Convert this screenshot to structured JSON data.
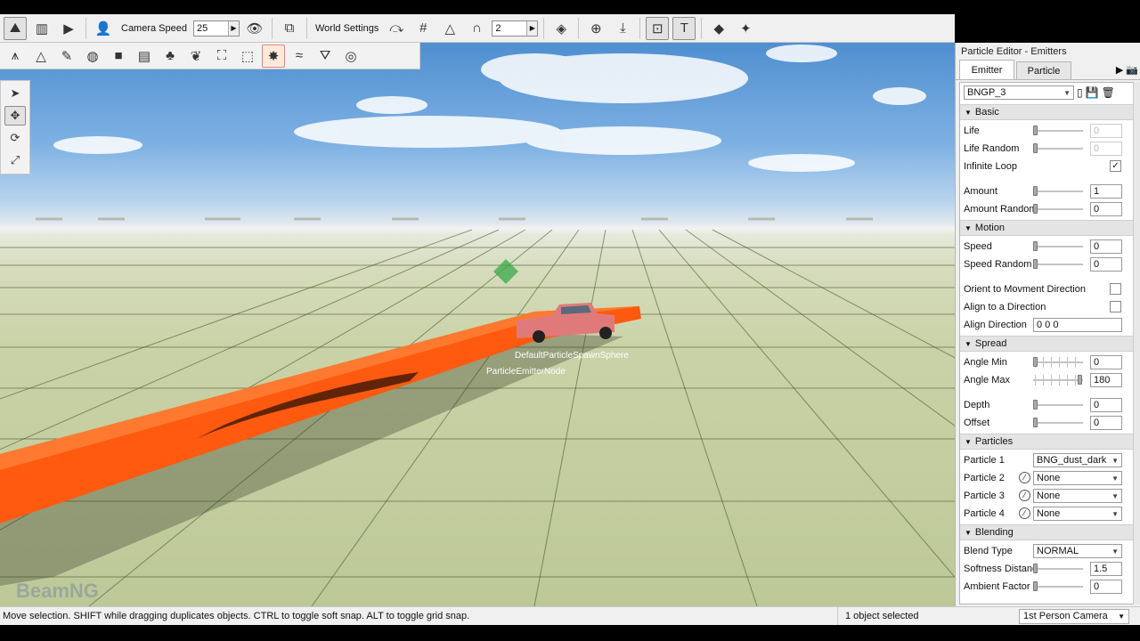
{
  "toolbar": {
    "camera_speed_label": "Camera Speed",
    "camera_speed_value": "25",
    "world_settings_label": "World Settings",
    "snap_value": "2"
  },
  "viewport": {
    "node_labels": [
      "DefaultParticleSpawnSphere",
      "ParticleEmitterNode"
    ],
    "watermark": "BeamNG"
  },
  "status": {
    "message": "Move selection.  SHIFT while dragging duplicates objects.  CTRL to toggle soft snap.  ALT to toggle grid snap.",
    "selection": "1 object selected",
    "camera": "1st Person Camera"
  },
  "panel": {
    "title": "Particle Editor - Emitters",
    "tabs": [
      "Emitter",
      "Particle"
    ],
    "emitter_name": "BNGP_3",
    "sections": {
      "basic": "Basic",
      "motion": "Motion",
      "spread": "Spread",
      "particles": "Particles",
      "blending": "Blending"
    },
    "basic": {
      "life": {
        "label": "Life",
        "value": "0"
      },
      "life_random": {
        "label": "Life Random",
        "value": "0"
      },
      "infinite_loop": {
        "label": "Infinite Loop",
        "checked": "✓"
      },
      "amount": {
        "label": "Amount",
        "value": "1"
      },
      "amount_random": {
        "label": "Amount Random",
        "value": "0"
      }
    },
    "motion": {
      "speed": {
        "label": "Speed",
        "value": "0"
      },
      "speed_random": {
        "label": "Speed Random",
        "value": "0"
      },
      "orient": {
        "label": "Orient to Movment Direction"
      },
      "align": {
        "label": "Align to a Direction"
      },
      "align_dir": {
        "label": "Align Direction",
        "value": "0 0 0"
      }
    },
    "spread": {
      "angle_min": {
        "label": "Angle Min",
        "value": "0"
      },
      "angle_max": {
        "label": "Angle Max",
        "value": "180"
      },
      "depth": {
        "label": "Depth",
        "value": "0"
      },
      "offset": {
        "label": "Offset",
        "value": "0"
      }
    },
    "particles": {
      "p1": {
        "label": "Particle 1",
        "value": "BNG_dust_dark"
      },
      "p2": {
        "label": "Particle 2",
        "value": "None"
      },
      "p3": {
        "label": "Particle 3",
        "value": "None"
      },
      "p4": {
        "label": "Particle 4",
        "value": "None"
      }
    },
    "blending": {
      "blend_type": {
        "label": "Blend Type",
        "value": "NORMAL"
      },
      "softness": {
        "label": "Softness Distance",
        "value": "1.5"
      },
      "ambient": {
        "label": "Ambient Factor",
        "value": "0"
      }
    }
  }
}
